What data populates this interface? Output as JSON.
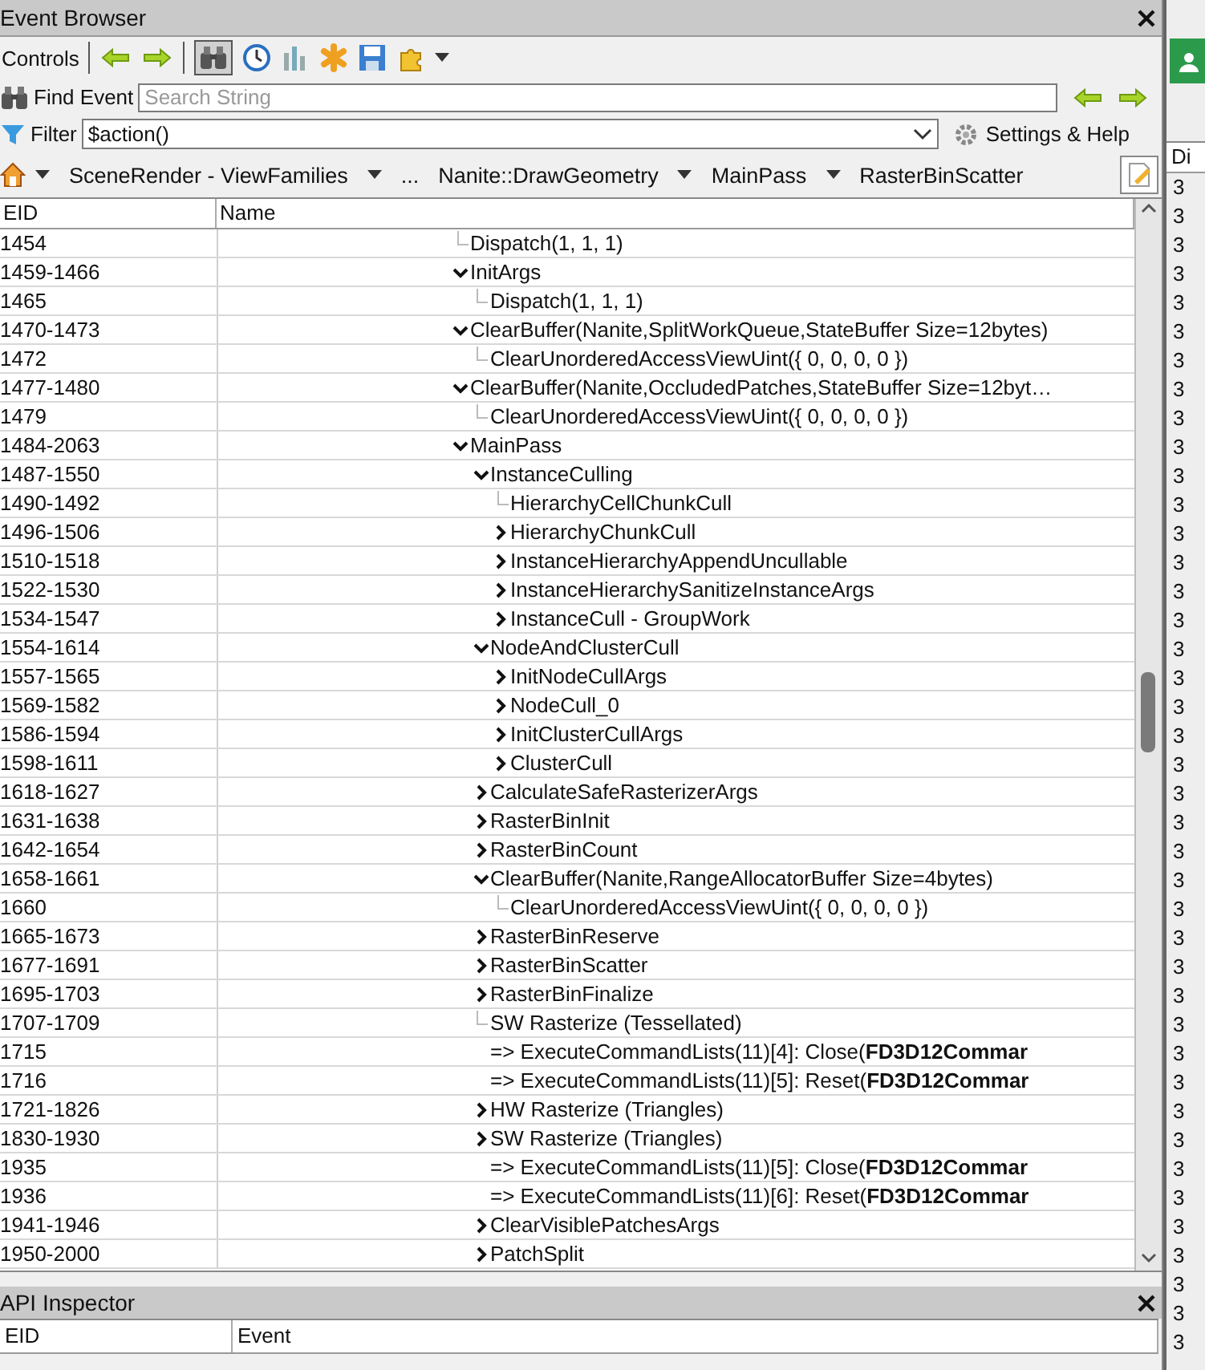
{
  "window": {
    "title": "Event Browser"
  },
  "controls": {
    "label": "Controls",
    "find_pressed": true
  },
  "find": {
    "label": "Find Event",
    "placeholder": "Search String"
  },
  "filter": {
    "label": "Filter",
    "value": "$action()",
    "settings": "Settings & Help"
  },
  "breadcrumbs": [
    {
      "label": "SceneRender - ViewFamilies",
      "menu": true
    },
    {
      "label": "...",
      "menu": false
    },
    {
      "label": "Nanite::DrawGeometry",
      "menu": true
    },
    {
      "label": "MainPass",
      "menu": true
    },
    {
      "label": "RasterBinScatter",
      "menu": false
    }
  ],
  "table": {
    "columns": [
      "EID",
      "Name"
    ],
    "rows": [
      {
        "eid": "1454",
        "name": "Dispatch(1, 1, 1)",
        "kind": "event"
      },
      {
        "eid": "1459-1466",
        "name": "InitArgs",
        "kind": "group",
        "expanded": true,
        "children": [
          {
            "eid": "1465",
            "name": "Dispatch(1, 1, 1)",
            "kind": "event"
          }
        ]
      },
      {
        "eid": "1470-1473",
        "name": "ClearBuffer(Nanite,SplitWorkQueue,StateBuffer Size=12bytes)",
        "kind": "group",
        "expanded": true,
        "children": [
          {
            "eid": "1472",
            "name": "ClearUnorderedAccessViewUint({ 0, 0, 0, 0 })",
            "kind": "event"
          }
        ]
      },
      {
        "eid": "1477-1480",
        "name": "ClearBuffer(Nanite,OccludedPatches,StateBuffer Size=12byt…",
        "kind": "group",
        "expanded": true,
        "children": [
          {
            "eid": "1479",
            "name": "ClearUnorderedAccessViewUint({ 0, 0, 0, 0 })",
            "kind": "event"
          }
        ]
      },
      {
        "eid": "1484-2063",
        "name": "MainPass",
        "kind": "group",
        "expanded": true,
        "children": [
          {
            "eid": "1487-1550",
            "name": "InstanceCulling",
            "kind": "group",
            "expanded": true,
            "children": [
              {
                "eid": "1490-1492",
                "name": "HierarchyCellChunkCull",
                "kind": "event"
              },
              {
                "eid": "1496-1506",
                "name": "HierarchyChunkCull",
                "kind": "group",
                "expanded": false
              },
              {
                "eid": "1510-1518",
                "name": "InstanceHierarchyAppendUncullable",
                "kind": "group",
                "expanded": false
              },
              {
                "eid": "1522-1530",
                "name": "InstanceHierarchySanitizeInstanceArgs",
                "kind": "group",
                "expanded": false
              },
              {
                "eid": "1534-1547",
                "name": "InstanceCull - GroupWork",
                "kind": "group",
                "expanded": false
              }
            ]
          },
          {
            "eid": "1554-1614",
            "name": "NodeAndClusterCull",
            "kind": "group",
            "expanded": true,
            "children": [
              {
                "eid": "1557-1565",
                "name": "InitNodeCullArgs",
                "kind": "group",
                "expanded": false
              },
              {
                "eid": "1569-1582",
                "name": "NodeCull_0",
                "kind": "group",
                "expanded": false
              },
              {
                "eid": "1586-1594",
                "name": "InitClusterCullArgs",
                "kind": "group",
                "expanded": false
              },
              {
                "eid": "1598-1611",
                "name": "ClusterCull",
                "kind": "group",
                "expanded": false
              }
            ]
          },
          {
            "eid": "1618-1627",
            "name": "CalculateSafeRasterizerArgs",
            "kind": "group",
            "expanded": false
          },
          {
            "eid": "1631-1638",
            "name": "RasterBinInit",
            "kind": "group",
            "expanded": false
          },
          {
            "eid": "1642-1654",
            "name": "RasterBinCount",
            "kind": "group",
            "expanded": false
          },
          {
            "eid": "1658-1661",
            "name": "ClearBuffer(Nanite,RangeAllocatorBuffer Size=4bytes)",
            "kind": "group",
            "expanded": true,
            "children": [
              {
                "eid": "1660",
                "name": "ClearUnorderedAccessViewUint({ 0, 0, 0, 0 })",
                "kind": "event"
              }
            ]
          },
          {
            "eid": "1665-1673",
            "name": "RasterBinReserve",
            "kind": "group",
            "expanded": false
          },
          {
            "eid": "1677-1691",
            "name": "RasterBinScatter",
            "kind": "group",
            "expanded": false
          },
          {
            "eid": "1695-1703",
            "name": "RasterBinFinalize",
            "kind": "group",
            "expanded": false
          },
          {
            "eid": "1707-1709",
            "name": "SW Rasterize (Tessellated)",
            "kind": "event"
          },
          {
            "eid": "1715",
            "name": "=>  ExecuteCommandLists(11)[4]: Close(**FD3D12Commar**",
            "kind": "event",
            "connector": false
          },
          {
            "eid": "1716",
            "name": "=>  ExecuteCommandLists(11)[5]: Reset(**FD3D12Commar**",
            "kind": "event",
            "connector": false
          },
          {
            "eid": "1721-1826",
            "name": "HW Rasterize (Triangles)",
            "kind": "group",
            "expanded": false
          },
          {
            "eid": "1830-1930",
            "name": "SW Rasterize (Triangles)",
            "kind": "group",
            "expanded": false
          },
          {
            "eid": "1935",
            "name": "=>  ExecuteCommandLists(11)[5]: Close(**FD3D12Commar**",
            "kind": "event",
            "connector": false
          },
          {
            "eid": "1936",
            "name": "=>  ExecuteCommandLists(11)[6]: Reset(**FD3D12Commar**",
            "kind": "event",
            "connector": false
          },
          {
            "eid": "1941-1946",
            "name": "ClearVisiblePatchesArgs",
            "kind": "group",
            "expanded": false
          },
          {
            "eid": "1950-2000",
            "name": "PatchSplit",
            "kind": "group",
            "expanded": false
          }
        ]
      }
    ]
  },
  "api_inspector": {
    "title": "API Inspector",
    "columns": [
      "EID",
      "Event"
    ]
  },
  "side_panel": {
    "header": "Di",
    "cells": [
      "3",
      "3",
      "3",
      "3",
      "3",
      "3",
      "3",
      "3",
      "3",
      "3",
      "3",
      "3",
      "3",
      "3",
      "3",
      "3",
      "3",
      "3",
      "3",
      "3",
      "3",
      "3",
      "3",
      "3",
      "3",
      "3",
      "3",
      "3",
      "3",
      "3",
      "3",
      "3",
      "3",
      "3",
      "3",
      "3",
      "3",
      "3",
      "3",
      "3",
      "3"
    ]
  }
}
